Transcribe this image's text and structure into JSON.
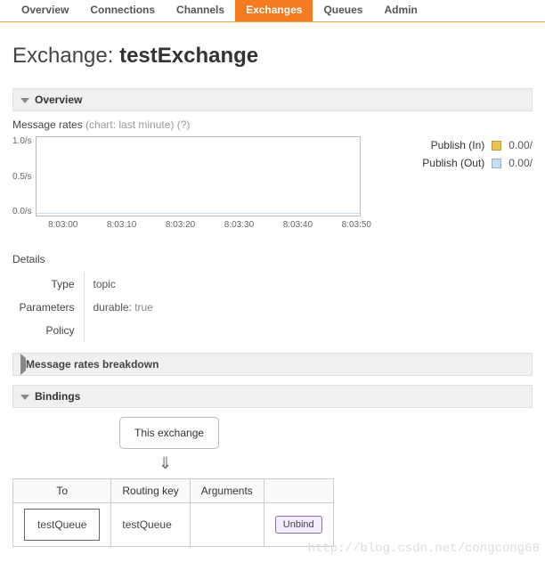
{
  "tabs": {
    "items": [
      {
        "label": "Overview",
        "active": false
      },
      {
        "label": "Connections",
        "active": false
      },
      {
        "label": "Channels",
        "active": false
      },
      {
        "label": "Exchanges",
        "active": true
      },
      {
        "label": "Queues",
        "active": false
      },
      {
        "label": "Admin",
        "active": false
      }
    ]
  },
  "title": {
    "prefix": "Exchange: ",
    "name": "testExchange"
  },
  "sections": {
    "overview": "Overview",
    "mrb": "Message rates breakdown",
    "bindings": "Bindings"
  },
  "rates": {
    "label": "Message rates ",
    "sub": "(chart: last minute) (?)",
    "legend": [
      {
        "label": "Publish (In)",
        "color": "#e8c252",
        "value": "0.00/"
      },
      {
        "label": "Publish (Out)",
        "color": "#c5dff0",
        "value": "0.00/"
      }
    ]
  },
  "chart_data": {
    "type": "line",
    "y_ticks": [
      "1.0/s",
      "0.5/s",
      "0.0/s"
    ],
    "x_ticks": [
      "8:03:00",
      "8:03:10",
      "8:03:20",
      "8:03:30",
      "8:03:40",
      "8:03:50"
    ],
    "ylim": [
      0,
      1
    ],
    "series": [
      {
        "name": "Publish (In)",
        "values": [
          0,
          0,
          0,
          0,
          0,
          0
        ]
      },
      {
        "name": "Publish (Out)",
        "values": [
          0,
          0,
          0,
          0,
          0,
          0
        ]
      }
    ],
    "xlabel": "",
    "ylabel": ""
  },
  "details": {
    "heading": "Details",
    "rows": [
      {
        "k": "Type",
        "v": "topic"
      },
      {
        "k": "Parameters",
        "v": "durable: ",
        "extra": "true"
      },
      {
        "k": "Policy",
        "v": ""
      }
    ]
  },
  "bindings": {
    "this_exchange": "This exchange",
    "arrow": "⇓",
    "headers": [
      "To",
      "Routing key",
      "Arguments",
      ""
    ],
    "rows": [
      {
        "to": "testQueue",
        "routing_key": "testQueue",
        "arguments": "",
        "unbind": "Unbind"
      }
    ]
  },
  "watermark": "http://blog.csdn.net/congcong68"
}
